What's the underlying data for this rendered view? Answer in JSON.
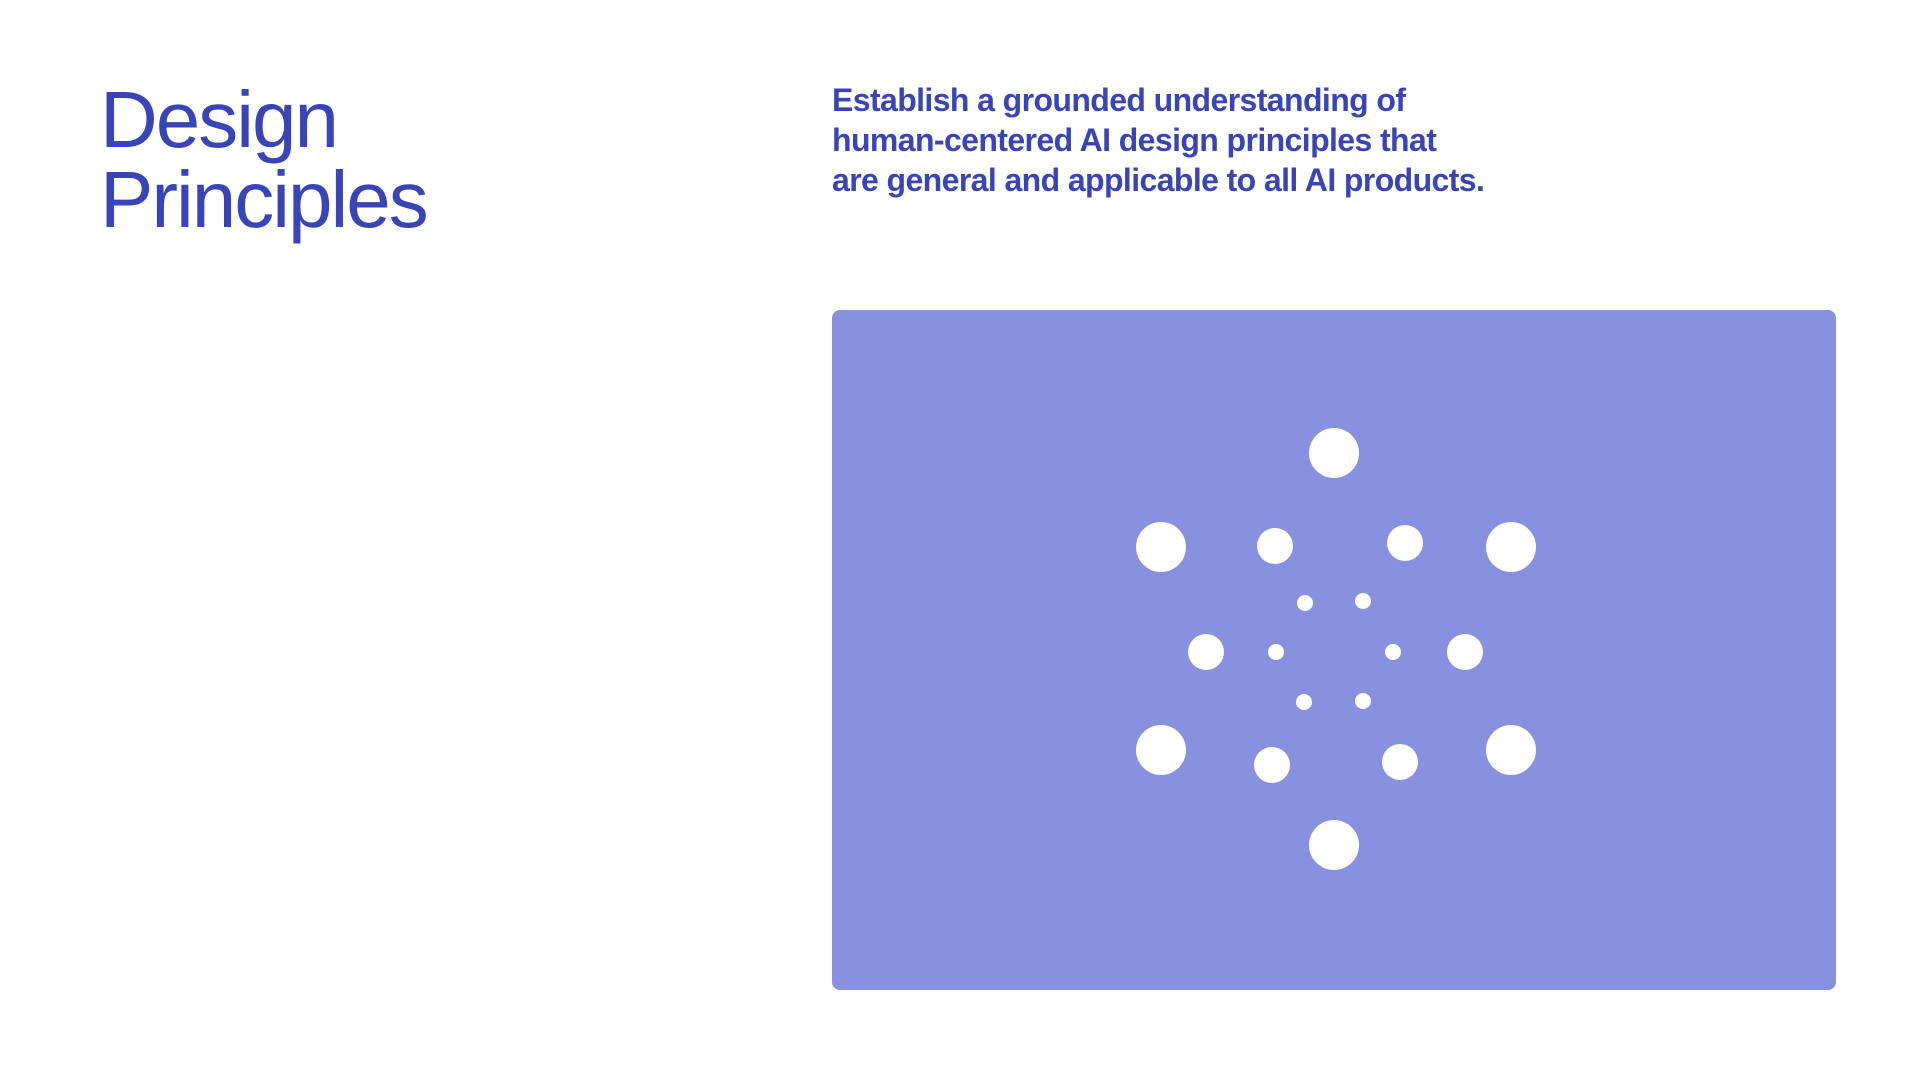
{
  "title": {
    "line1": "Design",
    "line2": "Principles"
  },
  "description": {
    "line1": "Establish a grounded understanding of",
    "line2": "human-centered AI design principles that",
    "line3": "are general and applicable to all AI products."
  },
  "illustration": {
    "background_color": "#8891df",
    "dot_color": "#ffffff",
    "accent_color": "#3844b8"
  }
}
